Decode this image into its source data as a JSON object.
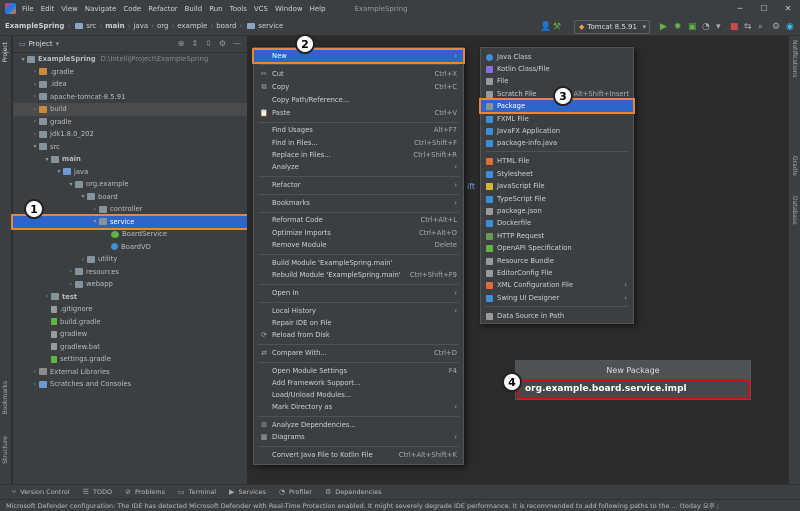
{
  "menubar": {
    "items": [
      "File",
      "Edit",
      "View",
      "Navigate",
      "Code",
      "Refactor",
      "Build",
      "Run",
      "Tools",
      "VCS",
      "Window",
      "Help"
    ],
    "title": "ExampleSpring"
  },
  "breadcrumbs": [
    "ExampleSpring",
    "src",
    "main",
    "java",
    "org",
    "example",
    "board",
    "service"
  ],
  "toolbar": {
    "run_config": "Tomcat 8.5.91"
  },
  "project": {
    "header": "Project",
    "tree": [
      {
        "label": "ExampleSpring",
        "path": "D:\\IntelliJProject\\ExampleSpring"
      },
      {
        "label": ".gradle"
      },
      {
        "label": ".idea"
      },
      {
        "label": "apache-tomcat-8.5.91"
      },
      {
        "label": "build"
      },
      {
        "label": "gradle"
      },
      {
        "label": "jdk1.8.0_202"
      },
      {
        "label": "src"
      },
      {
        "label": "main"
      },
      {
        "label": "java"
      },
      {
        "label": "org.example"
      },
      {
        "label": "board"
      },
      {
        "label": "controller"
      },
      {
        "label": "service"
      },
      {
        "label": "BoardService"
      },
      {
        "label": "BoardVO"
      },
      {
        "label": "utility"
      },
      {
        "label": "resources"
      },
      {
        "label": "webapp"
      },
      {
        "label": "test"
      },
      {
        "label": ".gitignore"
      },
      {
        "label": "build.gradle"
      },
      {
        "label": "gradlew"
      },
      {
        "label": "gradlew.bat"
      },
      {
        "label": "settings.gradle"
      },
      {
        "label": "External Libraries"
      },
      {
        "label": "Scratches and Consoles"
      }
    ]
  },
  "context_menu": [
    {
      "label": "New",
      "shortcut": ""
    },
    {
      "label": "Cut",
      "shortcut": "Ctrl+X"
    },
    {
      "label": "Copy",
      "shortcut": "Ctrl+C"
    },
    {
      "label": "Copy Path/Reference...",
      "shortcut": ""
    },
    {
      "label": "Paste",
      "shortcut": "Ctrl+V"
    },
    {
      "label": "Find Usages",
      "shortcut": "Alt+F7"
    },
    {
      "label": "Find in Files...",
      "shortcut": "Ctrl+Shift+F"
    },
    {
      "label": "Replace in Files...",
      "shortcut": "Ctrl+Shift+R"
    },
    {
      "label": "Analyze",
      "shortcut": ""
    },
    {
      "label": "Refactor",
      "shortcut": ""
    },
    {
      "label": "Bookmarks",
      "shortcut": ""
    },
    {
      "label": "Reformat Code",
      "shortcut": "Ctrl+Alt+L"
    },
    {
      "label": "Optimize Imports",
      "shortcut": "Ctrl+Alt+O"
    },
    {
      "label": "Remove Module",
      "shortcut": "Delete"
    },
    {
      "label": "Build Module 'ExampleSpring.main'",
      "shortcut": ""
    },
    {
      "label": "Rebuild Module 'ExampleSpring.main'",
      "shortcut": "Ctrl+Shift+F9"
    },
    {
      "label": "Open In",
      "shortcut": ""
    },
    {
      "label": "Local History",
      "shortcut": ""
    },
    {
      "label": "Repair IDE on File",
      "shortcut": ""
    },
    {
      "label": "Reload from Disk",
      "shortcut": ""
    },
    {
      "label": "Compare With...",
      "shortcut": "Ctrl+D"
    },
    {
      "label": "Open Module Settings",
      "shortcut": "F4"
    },
    {
      "label": "Add Framework Support...",
      "shortcut": ""
    },
    {
      "label": "Load/Unload Modules...",
      "shortcut": ""
    },
    {
      "label": "Mark Directory as",
      "shortcut": ""
    },
    {
      "label": "Analyze Dependencies...",
      "shortcut": ""
    },
    {
      "label": "Diagrams",
      "shortcut": ""
    },
    {
      "label": "Convert Java File to Kotlin File",
      "shortcut": "Ctrl+Alt+Shift+K"
    }
  ],
  "new_submenu": [
    {
      "label": "Java Class",
      "shortcut": "",
      "color": "#3f8fd2"
    },
    {
      "label": "Kotlin Class/File",
      "shortcut": "",
      "color": "#8f6de0"
    },
    {
      "label": "File",
      "shortcut": "",
      "color": "#9a9a9a"
    },
    {
      "label": "Scratch File",
      "shortcut": "Ctrl+Alt+Shift+Insert",
      "color": "#9a9a9a"
    },
    {
      "label": "Package",
      "shortcut": "",
      "color": "#87939a"
    },
    {
      "label": "FXML File",
      "shortcut": "",
      "color": "#3f8fd2"
    },
    {
      "label": "JavaFX Application",
      "shortcut": "",
      "color": "#3f8fd2"
    },
    {
      "label": "package-info.java",
      "shortcut": "",
      "color": "#3f8fd2"
    },
    {
      "label": "HTML File",
      "shortcut": "",
      "color": "#e06c3a"
    },
    {
      "label": "Stylesheet",
      "shortcut": "",
      "color": "#3f8fd2"
    },
    {
      "label": "JavaScript File",
      "shortcut": "",
      "color": "#d3b53c"
    },
    {
      "label": "TypeScript File",
      "shortcut": "",
      "color": "#3f8fd2"
    },
    {
      "label": "package.json",
      "shortcut": "",
      "color": "#9a9a9a"
    },
    {
      "label": "Dockerfile",
      "shortcut": "",
      "color": "#3f8fd2"
    },
    {
      "label": "HTTP Request",
      "shortcut": "",
      "color": "#6a9955"
    },
    {
      "label": "OpenAPI Specification",
      "shortcut": "",
      "color": "#62b543"
    },
    {
      "label": "Resource Bundle",
      "shortcut": "",
      "color": "#9a9a9a"
    },
    {
      "label": "EditorConfig File",
      "shortcut": "",
      "color": "#9a9a9a"
    },
    {
      "label": "XML Configuration File",
      "shortcut": "",
      "color": "#e06c3a"
    },
    {
      "label": "Swing UI Designer",
      "shortcut": "",
      "color": "#3f8fd2"
    },
    {
      "label": "Data Source in Path",
      "shortcut": "",
      "color": "#9a9a9a"
    }
  ],
  "new_package": {
    "title": "New Package",
    "value": "org.example.board.service.impl"
  },
  "editor_hint": "ift",
  "badges": [
    "1",
    "2",
    "3",
    "4"
  ],
  "right_strip": [
    "Notifications",
    "Gradle",
    "Database"
  ],
  "left_strip": [
    "Project",
    "Bookmarks",
    "Structure"
  ],
  "bottom_tabs": [
    "Version Control",
    "TODO",
    "Problems",
    "Terminal",
    "Services",
    "Profiler",
    "Dependencies"
  ],
  "status": "Microsoft Defender configuration: The IDE has detected Microsoft Defender with Real-Time Protection enabled. It might severely degrade IDE performance. It is recommended to add following paths to the ... (today 오후 ;",
  "colors": {
    "selection": "#2f65ca",
    "highlight_outline": "#e8873a",
    "input_outline": "#c0151c"
  }
}
